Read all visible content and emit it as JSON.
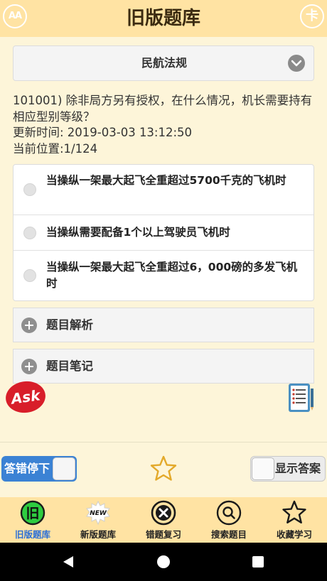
{
  "header": {
    "title": "旧版题库",
    "font_button_label": "AA",
    "card_button_label": "卡"
  },
  "category": {
    "selected": "民航法规"
  },
  "question": {
    "text": "101001) 除非局方另有授权，在什么情况，机长需要持有相应型别等级？",
    "updated": "更新时间: 2019-03-03 13:12:50",
    "position": "当前位置:1/124"
  },
  "options": [
    {
      "text": "当操纵一架最大起飞全重超过5700千克的飞机时"
    },
    {
      "text": "当操纵需要配备1个以上驾驶员飞机时"
    },
    {
      "text": "当操纵一架最大起飞全重超过6，000磅的多发飞机时"
    }
  ],
  "sections": {
    "analysis": "题目解析",
    "notes": "题目笔记"
  },
  "floating": {
    "ask_logo": "Ask"
  },
  "controls": {
    "stop_on_wrong_label": "答错停下",
    "show_answer_label": "显示答案"
  },
  "bottom_nav": {
    "items": [
      {
        "label": "旧版题库",
        "icon": "old-bank-icon"
      },
      {
        "label": "新版题库",
        "icon": "new-badge-icon"
      },
      {
        "label": "错题复习",
        "icon": "x-circle-icon"
      },
      {
        "label": "搜索题目",
        "icon": "search-icon"
      },
      {
        "label": "收藏学习",
        "icon": "star-icon"
      }
    ],
    "old_icon_glyph": "旧",
    "new_icon_glyph": "NEW"
  },
  "colors": {
    "header_bg": "#ffe3a3",
    "page_bg": "#fdf5d9",
    "accent_blue": "#3b82d4",
    "active_green": "#2ecc40",
    "ask_red": "#d81e2a"
  }
}
